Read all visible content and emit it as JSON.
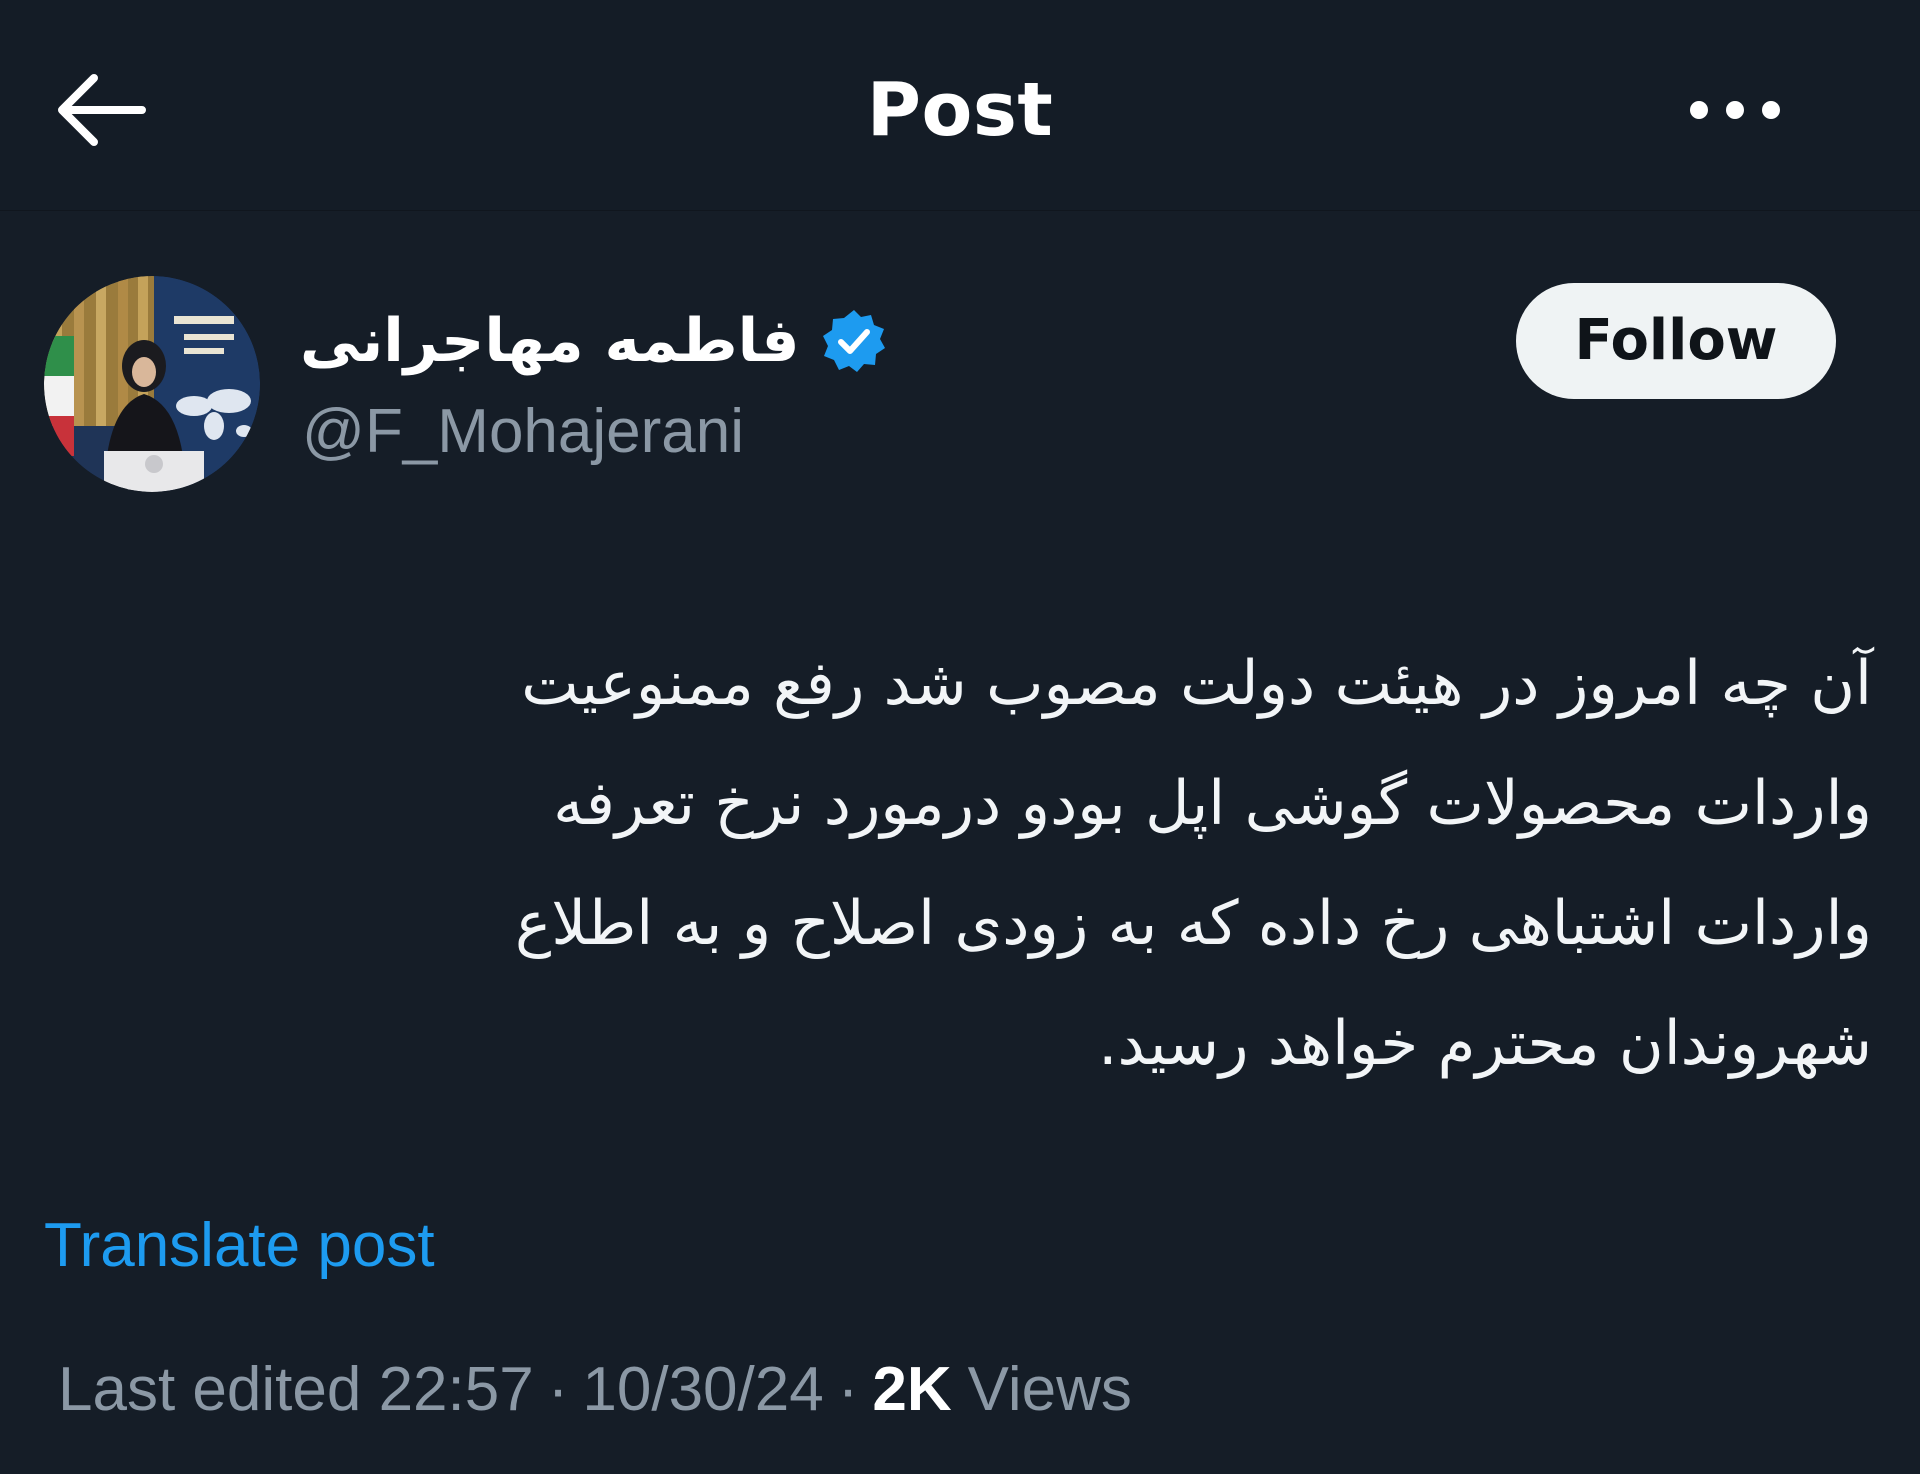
{
  "header": {
    "title": "Post",
    "back_icon": "arrow-left-icon",
    "more_icon": "more-horizontal-icon"
  },
  "author": {
    "name": "فاطمه مهاجرانی",
    "handle": "@F_Mohajerani",
    "verified": true,
    "verified_color": "#1d9bf0",
    "follow_label": "Follow"
  },
  "post": {
    "lines": [
      "آن چه امروز در هیئت دولت مصوب شد رفع ممنوعیت",
      "واردات محصولات گوشی اپل بودو درمورد نرخ تعرفه",
      "واردات اشتباهی رخ داده که به زودی اصلاح و به اطلاع",
      "شهروندان محترم خواهد رسید."
    ]
  },
  "translate_label": "Translate post",
  "meta": {
    "edited_label": "Last edited 22:57",
    "separator": "·",
    "date": "10/30/24",
    "views_count": "2K",
    "views_label": "Views"
  },
  "colors": {
    "background": "#151d27",
    "text": "#f7f9f9",
    "secondary": "#8b98a5",
    "link": "#1d9bf0"
  }
}
